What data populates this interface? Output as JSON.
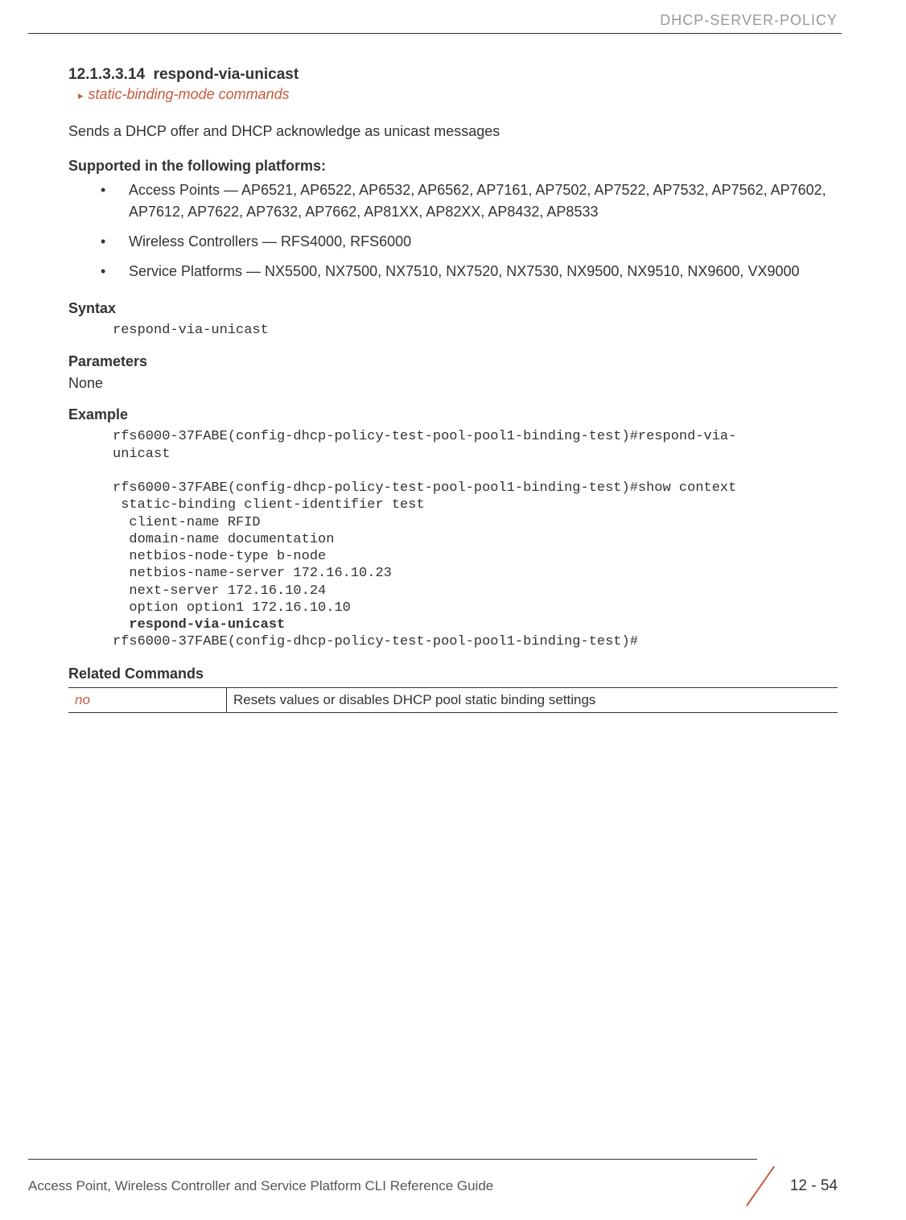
{
  "header": {
    "running_title": "DHCP-SERVER-POLICY"
  },
  "section": {
    "number": "12.1.3.3.14",
    "title": "respond-via-unicast",
    "breadcrumb": "static-binding-mode commands",
    "description": "Sends a DHCP offer and DHCP acknowledge as unicast messages"
  },
  "supported": {
    "heading": "Supported in the following platforms:",
    "items": [
      "Access Points — AP6521, AP6522, AP6532, AP6562, AP7161, AP7502, AP7522, AP7532, AP7562, AP7602, AP7612, AP7622, AP7632, AP7662, AP81XX, AP82XX, AP8432, AP8533",
      "Wireless Controllers — RFS4000, RFS6000",
      "Service Platforms — NX5500, NX7500, NX7510, NX7520, NX7530, NX9500, NX9510, NX9600, VX9000"
    ]
  },
  "syntax": {
    "heading": "Syntax",
    "code": "respond-via-unicast"
  },
  "parameters": {
    "heading": "Parameters",
    "value": "None"
  },
  "example": {
    "heading": "Example",
    "line1": "rfs6000-37FABE(config-dhcp-policy-test-pool-pool1-binding-test)#respond-via-",
    "line2": "unicast",
    "blank": "",
    "line3": "rfs6000-37FABE(config-dhcp-policy-test-pool-pool1-binding-test)#show context",
    "line4": " static-binding client-identifier test",
    "line5": "  client-name RFID",
    "line6": "  domain-name documentation",
    "line7": "  netbios-node-type b-node",
    "line8": "  netbios-name-server 172.16.10.23",
    "line9": "  next-server 172.16.10.24",
    "line10": "  option option1 172.16.10.10",
    "line11_bold": "  respond-via-unicast",
    "line12": "rfs6000-37FABE(config-dhcp-policy-test-pool-pool1-binding-test)#"
  },
  "related": {
    "heading": "Related Commands",
    "rows": [
      {
        "cmd": "no",
        "desc": "Resets values or disables DHCP pool static binding settings"
      }
    ]
  },
  "footer": {
    "guide_title": "Access Point, Wireless Controller and Service Platform CLI Reference Guide",
    "page": "12 - 54"
  }
}
